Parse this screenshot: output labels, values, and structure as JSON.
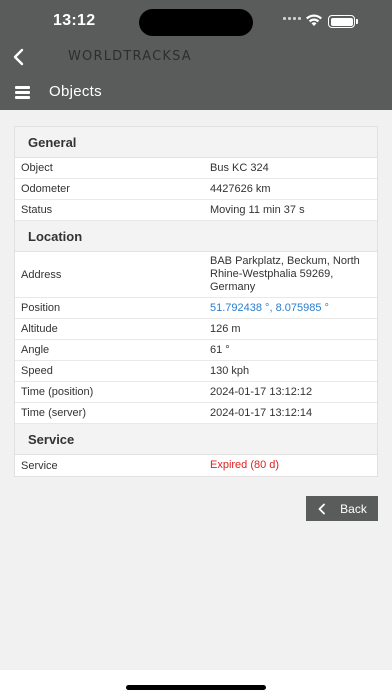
{
  "status_bar": {
    "time": "13:12"
  },
  "header": {
    "logo_text": "WORLDTRACKSA"
  },
  "nav": {
    "title": "Objects"
  },
  "sections": {
    "general": {
      "title": "General",
      "rows": [
        {
          "key": "Object",
          "value": "Bus KC 324"
        },
        {
          "key": "Odometer",
          "value": "4427626 km"
        },
        {
          "key": "Status",
          "value": "Moving 11 min 37 s"
        }
      ]
    },
    "location": {
      "title": "Location",
      "rows": [
        {
          "key": "Address",
          "value": "BAB Parkplatz, Beckum, North Rhine-Westphalia 59269, Germany"
        },
        {
          "key": "Position",
          "value": "51.792438 °, 8.075985 °"
        },
        {
          "key": "Altitude",
          "value": "126 m"
        },
        {
          "key": "Angle",
          "value": "61 °"
        },
        {
          "key": "Speed",
          "value": "130 kph"
        },
        {
          "key": "Time (position)",
          "value": "2024-01-17 13:12:12"
        },
        {
          "key": "Time (server)",
          "value": "2024-01-17 13:12:14"
        }
      ]
    },
    "service": {
      "title": "Service",
      "rows": [
        {
          "key": "Service",
          "value": "Expired (80 d)"
        }
      ]
    }
  },
  "actions": {
    "back_label": "Back"
  },
  "colors": {
    "link": "#2a7fd0",
    "danger": "#e02020",
    "header_bg": "#5a5b5b"
  }
}
